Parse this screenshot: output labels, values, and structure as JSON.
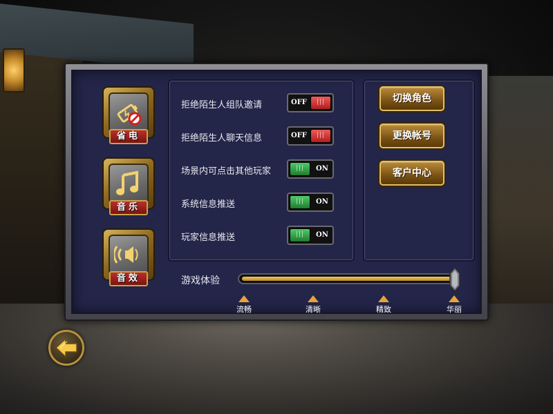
{
  "modes": {
    "power_save": {
      "label": "省电",
      "icon": "battery-saver-icon"
    },
    "music": {
      "label": "音乐",
      "icon": "music-note-icon"
    },
    "sound": {
      "label": "音效",
      "icon": "speaker-icon"
    }
  },
  "settings": [
    {
      "label": "拒绝陌生人组队邀请",
      "state": "OFF"
    },
    {
      "label": "拒绝陌生人聊天信息",
      "state": "OFF"
    },
    {
      "label": "场景内可点击其他玩家",
      "state": "ON"
    },
    {
      "label": "系统信息推送",
      "state": "ON"
    },
    {
      "label": "玩家信息推送",
      "state": "ON"
    }
  ],
  "toggle_knob_glyph": "|||",
  "account": {
    "switch_role": "切换角色",
    "change_account": "更换帐号",
    "customer_center": "客户中心"
  },
  "quality": {
    "label": "游戏体验",
    "level": 1.0,
    "ticks": [
      "流畅",
      "清晰",
      "精致",
      "华丽"
    ],
    "selected": "华丽"
  },
  "colors": {
    "accent_gold": "#e2bf6a",
    "label_red": "#b8302c",
    "toggle_on": "#1f7c2e",
    "toggle_off": "#b01e1e",
    "panel_bg": "#232549",
    "tick_orange": "#e8a23a"
  },
  "back_button": {
    "icon": "back-arrow-icon"
  }
}
